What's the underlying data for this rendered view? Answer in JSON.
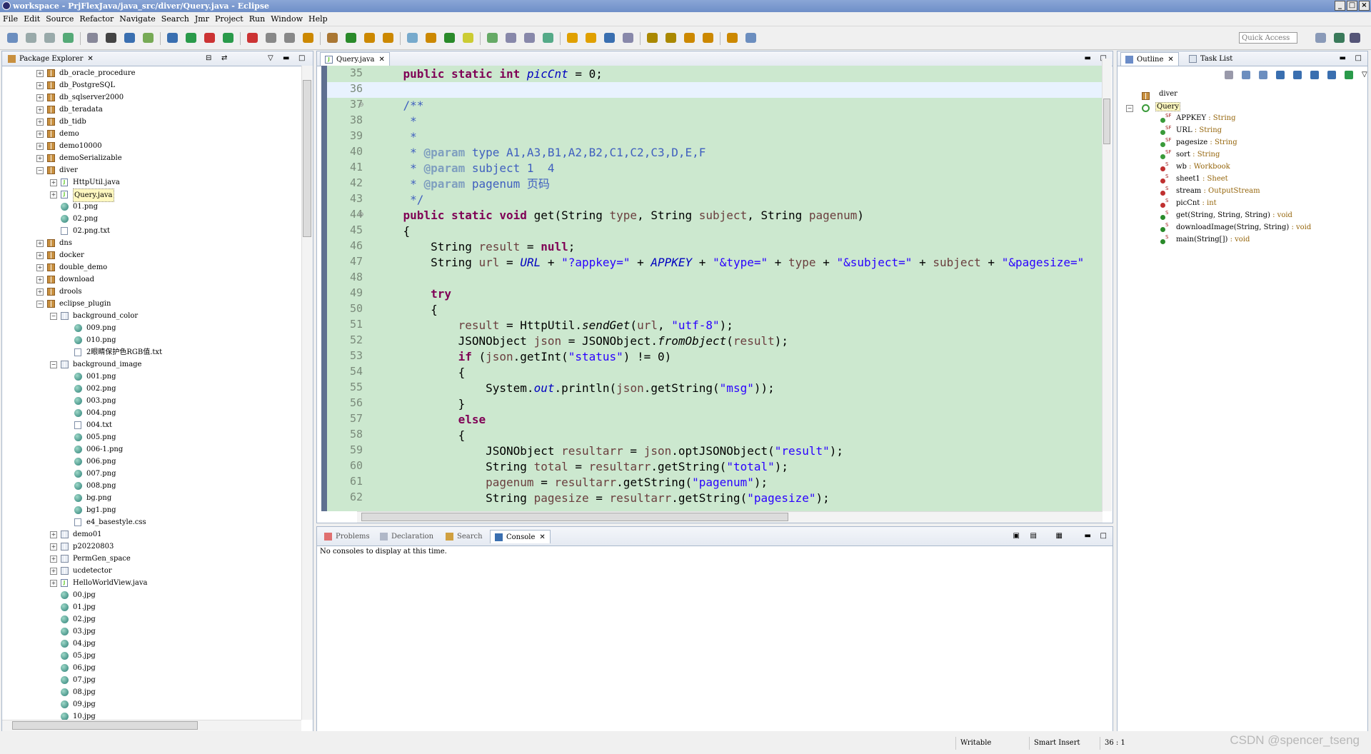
{
  "window": {
    "title": "workspace - PrjFlexJava/java_src/diver/Query.java - Eclipse"
  },
  "menu": [
    "File",
    "Edit",
    "Source",
    "Refactor",
    "Navigate",
    "Search",
    "Jmr",
    "Project",
    "Run",
    "Window",
    "Help"
  ],
  "quick_access": {
    "placeholder": "Quick Access"
  },
  "package_explorer": {
    "title": "Package Explorer",
    "items": [
      {
        "label": "db_oracle_procedure",
        "indent": 0,
        "kind": "pkg",
        "toggle": "+"
      },
      {
        "label": "db_PostgreSQL",
        "indent": 0,
        "kind": "pkg",
        "toggle": "+"
      },
      {
        "label": "db_sqlserver2000",
        "indent": 0,
        "kind": "pkg",
        "toggle": "+"
      },
      {
        "label": "db_teradata",
        "indent": 0,
        "kind": "pkg",
        "toggle": "+"
      },
      {
        "label": "db_tidb",
        "indent": 0,
        "kind": "pkg",
        "toggle": "+"
      },
      {
        "label": "demo",
        "indent": 0,
        "kind": "pkg",
        "toggle": "+"
      },
      {
        "label": "demo10000",
        "indent": 0,
        "kind": "pkg",
        "toggle": "+"
      },
      {
        "label": "demoSerializable",
        "indent": 0,
        "kind": "pkg",
        "toggle": "+"
      },
      {
        "label": "diver",
        "indent": 0,
        "kind": "pkg",
        "toggle": "-"
      },
      {
        "label": "HttpUtil.java",
        "indent": 1,
        "kind": "java",
        "toggle": "+"
      },
      {
        "label": "Query.java",
        "indent": 1,
        "kind": "java",
        "toggle": "+",
        "selected": true
      },
      {
        "label": "01.png",
        "indent": 1,
        "kind": "img"
      },
      {
        "label": "02.png",
        "indent": 1,
        "kind": "img"
      },
      {
        "label": "02.png.txt",
        "indent": 1,
        "kind": "file"
      },
      {
        "label": "dns",
        "indent": 0,
        "kind": "pkg",
        "toggle": "+"
      },
      {
        "label": "docker",
        "indent": 0,
        "kind": "pkg",
        "toggle": "+"
      },
      {
        "label": "double_demo",
        "indent": 0,
        "kind": "pkg",
        "toggle": "+"
      },
      {
        "label": "download",
        "indent": 0,
        "kind": "pkg",
        "toggle": "+"
      },
      {
        "label": "drools",
        "indent": 0,
        "kind": "pkg",
        "toggle": "+"
      },
      {
        "label": "eclipse_plugin",
        "indent": 0,
        "kind": "pkg",
        "toggle": "-"
      },
      {
        "label": "background_color",
        "indent": 1,
        "kind": "folder",
        "toggle": "-"
      },
      {
        "label": "009.png",
        "indent": 2,
        "kind": "img"
      },
      {
        "label": "010.png",
        "indent": 2,
        "kind": "img"
      },
      {
        "label": "2眼睛保护色RGB值.txt",
        "indent": 2,
        "kind": "file"
      },
      {
        "label": "background_image",
        "indent": 1,
        "kind": "folder",
        "toggle": "-"
      },
      {
        "label": "001.png",
        "indent": 2,
        "kind": "img"
      },
      {
        "label": "002.png",
        "indent": 2,
        "kind": "img"
      },
      {
        "label": "003.png",
        "indent": 2,
        "kind": "img"
      },
      {
        "label": "004.png",
        "indent": 2,
        "kind": "img"
      },
      {
        "label": "004.txt",
        "indent": 2,
        "kind": "file"
      },
      {
        "label": "005.png",
        "indent": 2,
        "kind": "img"
      },
      {
        "label": "006-1.png",
        "indent": 2,
        "kind": "img"
      },
      {
        "label": "006.png",
        "indent": 2,
        "kind": "img"
      },
      {
        "label": "007.png",
        "indent": 2,
        "kind": "img"
      },
      {
        "label": "008.png",
        "indent": 2,
        "kind": "img"
      },
      {
        "label": "bg.png",
        "indent": 2,
        "kind": "img"
      },
      {
        "label": "bg1.png",
        "indent": 2,
        "kind": "img"
      },
      {
        "label": "e4_basestyle.css",
        "indent": 2,
        "kind": "file"
      },
      {
        "label": "demo01",
        "indent": 1,
        "kind": "folder",
        "toggle": "+"
      },
      {
        "label": "p20220803",
        "indent": 1,
        "kind": "folder",
        "toggle": "+"
      },
      {
        "label": "PermGen_space",
        "indent": 1,
        "kind": "folder",
        "toggle": "+"
      },
      {
        "label": "ucdetector",
        "indent": 1,
        "kind": "folder",
        "toggle": "+"
      },
      {
        "label": "HelloWorldView.java",
        "indent": 1,
        "kind": "java",
        "toggle": "+"
      },
      {
        "label": "00.jpg",
        "indent": 1,
        "kind": "img"
      },
      {
        "label": "01.jpg",
        "indent": 1,
        "kind": "img"
      },
      {
        "label": "02.jpg",
        "indent": 1,
        "kind": "img"
      },
      {
        "label": "03.jpg",
        "indent": 1,
        "kind": "img"
      },
      {
        "label": "04.jpg",
        "indent": 1,
        "kind": "img"
      },
      {
        "label": "05.jpg",
        "indent": 1,
        "kind": "img"
      },
      {
        "label": "06.jpg",
        "indent": 1,
        "kind": "img"
      },
      {
        "label": "07.jpg",
        "indent": 1,
        "kind": "img"
      },
      {
        "label": "08.jpg",
        "indent": 1,
        "kind": "img"
      },
      {
        "label": "09.jpg",
        "indent": 1,
        "kind": "img"
      },
      {
        "label": "10.jpg",
        "indent": 1,
        "kind": "img"
      }
    ]
  },
  "editor": {
    "tab": "Query.java",
    "current_line": 36,
    "lines": [
      {
        "n": "35",
        "tokens": [
          [
            "",
            "    "
          ],
          [
            "kw",
            "public static int "
          ],
          [
            "fd it",
            "picCnt"
          ],
          [
            "",
            " = 0;"
          ]
        ]
      },
      {
        "n": "36",
        "tokens": []
      },
      {
        "n": "37",
        "fold": "⊖",
        "tokens": [
          [
            "cm",
            "    /**"
          ]
        ]
      },
      {
        "n": "38",
        "tokens": [
          [
            "cm",
            "     *"
          ]
        ]
      },
      {
        "n": "39",
        "tokens": [
          [
            "cm",
            "     *"
          ]
        ]
      },
      {
        "n": "40",
        "tokens": [
          [
            "cm",
            "     * "
          ],
          [
            "tag",
            "@param"
          ],
          [
            "cm",
            " type A1,A3,B1,A2,B2,C1,C2,C3,D,E,F"
          ]
        ]
      },
      {
        "n": "41",
        "tokens": [
          [
            "cm",
            "     * "
          ],
          [
            "tag",
            "@param"
          ],
          [
            "cm",
            " subject 1  4"
          ]
        ]
      },
      {
        "n": "42",
        "tokens": [
          [
            "cm",
            "     * "
          ],
          [
            "tag",
            "@param"
          ],
          [
            "cm",
            " pagenum 页码"
          ]
        ]
      },
      {
        "n": "43",
        "tokens": [
          [
            "cm",
            "     */"
          ]
        ]
      },
      {
        "n": "44",
        "fold": "⊖",
        "tokens": [
          [
            "",
            "    "
          ],
          [
            "kw",
            "public static void "
          ],
          [
            "",
            "get(String "
          ],
          [
            "lv",
            "type"
          ],
          [
            "",
            ", String "
          ],
          [
            "lv",
            "subject"
          ],
          [
            "",
            ", String "
          ],
          [
            "lv",
            "pagenum"
          ],
          [
            "",
            ")"
          ]
        ]
      },
      {
        "n": "45",
        "tokens": [
          [
            "",
            "    {"
          ]
        ]
      },
      {
        "n": "46",
        "tokens": [
          [
            "",
            "        String "
          ],
          [
            "lv",
            "result"
          ],
          [
            "",
            " = "
          ],
          [
            "kw",
            "null"
          ],
          [
            "",
            ";"
          ]
        ]
      },
      {
        "n": "47",
        "tokens": [
          [
            "",
            "        String "
          ],
          [
            "lv",
            "url"
          ],
          [
            "",
            " = "
          ],
          [
            "fd it",
            "URL"
          ],
          [
            "",
            " + "
          ],
          [
            "st",
            "\"?appkey=\""
          ],
          [
            "",
            " + "
          ],
          [
            "fd it",
            "APPKEY"
          ],
          [
            "",
            " + "
          ],
          [
            "st",
            "\"&type=\""
          ],
          [
            "",
            " + "
          ],
          [
            "lv",
            "type"
          ],
          [
            "",
            " + "
          ],
          [
            "st",
            "\"&subject=\""
          ],
          [
            "",
            " + "
          ],
          [
            "lv",
            "subject"
          ],
          [
            "",
            " + "
          ],
          [
            "st",
            "\"&pagesize=\""
          ]
        ]
      },
      {
        "n": "48",
        "tokens": []
      },
      {
        "n": "49",
        "tokens": [
          [
            "",
            "        "
          ],
          [
            "kw",
            "try"
          ]
        ]
      },
      {
        "n": "50",
        "tokens": [
          [
            "",
            "        {"
          ]
        ]
      },
      {
        "n": "51",
        "tokens": [
          [
            "",
            "            "
          ],
          [
            "lv",
            "result"
          ],
          [
            "",
            " = HttpUtil."
          ],
          [
            "it",
            "sendGet"
          ],
          [
            "",
            "("
          ],
          [
            "lv",
            "url"
          ],
          [
            "",
            ", "
          ],
          [
            "st",
            "\"utf-8\""
          ],
          [
            "",
            ");"
          ]
        ]
      },
      {
        "n": "52",
        "tokens": [
          [
            "",
            "            JSONObject "
          ],
          [
            "lv",
            "json"
          ],
          [
            "",
            " = JSONObject."
          ],
          [
            "it",
            "fromObject"
          ],
          [
            "",
            "("
          ],
          [
            "lv",
            "result"
          ],
          [
            "",
            ");"
          ]
        ]
      },
      {
        "n": "53",
        "tokens": [
          [
            "",
            "            "
          ],
          [
            "kw",
            "if"
          ],
          [
            "",
            " ("
          ],
          [
            "lv",
            "json"
          ],
          [
            "",
            ".getInt("
          ],
          [
            "st",
            "\"status\""
          ],
          [
            "",
            ") != 0)"
          ]
        ]
      },
      {
        "n": "54",
        "tokens": [
          [
            "",
            "            {"
          ]
        ]
      },
      {
        "n": "55",
        "tokens": [
          [
            "",
            "                System."
          ],
          [
            "fd it",
            "out"
          ],
          [
            "",
            ".println("
          ],
          [
            "lv",
            "json"
          ],
          [
            "",
            ".getString("
          ],
          [
            "st",
            "\"msg\""
          ],
          [
            "",
            "));"
          ]
        ]
      },
      {
        "n": "56",
        "tokens": [
          [
            "",
            "            }"
          ]
        ]
      },
      {
        "n": "57",
        "tokens": [
          [
            "",
            "            "
          ],
          [
            "kw",
            "else"
          ]
        ]
      },
      {
        "n": "58",
        "tokens": [
          [
            "",
            "            {"
          ]
        ]
      },
      {
        "n": "59",
        "tokens": [
          [
            "",
            "                JSONObject "
          ],
          [
            "lv",
            "resultarr"
          ],
          [
            "",
            " = "
          ],
          [
            "lv",
            "json"
          ],
          [
            "",
            ".optJSONObject("
          ],
          [
            "st",
            "\"result\""
          ],
          [
            "",
            ");"
          ]
        ]
      },
      {
        "n": "60",
        "tokens": [
          [
            "",
            "                String "
          ],
          [
            "lv",
            "total"
          ],
          [
            "",
            " = "
          ],
          [
            "lv",
            "resultarr"
          ],
          [
            "",
            ".getString("
          ],
          [
            "st",
            "\"total\""
          ],
          [
            "",
            ");"
          ]
        ]
      },
      {
        "n": "61",
        "tokens": [
          [
            "",
            "                "
          ],
          [
            "lv",
            "pagenum"
          ],
          [
            "",
            " = "
          ],
          [
            "lv",
            "resultarr"
          ],
          [
            "",
            ".getString("
          ],
          [
            "st",
            "\"pagenum\""
          ],
          [
            "",
            ");"
          ]
        ]
      },
      {
        "n": "62",
        "tokens": [
          [
            "",
            "                String "
          ],
          [
            "lv",
            "pagesize"
          ],
          [
            "",
            " = "
          ],
          [
            "lv",
            "resultarr"
          ],
          [
            "",
            ".getString("
          ],
          [
            "st",
            "\"pagesize\""
          ],
          [
            "",
            ");"
          ]
        ]
      }
    ]
  },
  "console": {
    "tabs": [
      "Problems",
      "Declaration",
      "Search",
      "Console"
    ],
    "active": "Console",
    "message": "No consoles to display at this time."
  },
  "outline": {
    "tabs": [
      "Outline",
      "Task List"
    ],
    "root": "diver",
    "class": "Query",
    "members": [
      {
        "name": "APPKEY",
        "type": "String",
        "mod": "SF",
        "color": "#3a9a3a"
      },
      {
        "name": "URL",
        "type": "String",
        "mod": "SF",
        "color": "#3a9a3a"
      },
      {
        "name": "pagesize",
        "type": "String",
        "mod": "SF",
        "color": "#3a9a3a"
      },
      {
        "name": "sort",
        "type": "String",
        "mod": "SF",
        "color": "#3a9a3a"
      },
      {
        "name": "wb",
        "type": "Workbook",
        "mod": "S",
        "color": "#c03030"
      },
      {
        "name": "sheet1",
        "type": "Sheet",
        "mod": "S",
        "color": "#c03030"
      },
      {
        "name": "stream",
        "type": "OutputStream",
        "mod": "S",
        "color": "#c03030"
      },
      {
        "name": "picCnt",
        "type": "int",
        "mod": "S",
        "color": "#c03030"
      },
      {
        "name": "get(String, String, String)",
        "type": "void",
        "mod": "S",
        "color": "#2a8a2a"
      },
      {
        "name": "downloadImage(String, String)",
        "type": "void",
        "mod": "S",
        "color": "#2a8a2a"
      },
      {
        "name": "main(String[])",
        "type": "void",
        "mod": "S",
        "color": "#2a8a2a"
      }
    ]
  },
  "status": {
    "writable": "Writable",
    "insert_mode": "Smart Insert",
    "position": "36 : 1",
    "watermark": "CSDN @spencer_tseng"
  }
}
